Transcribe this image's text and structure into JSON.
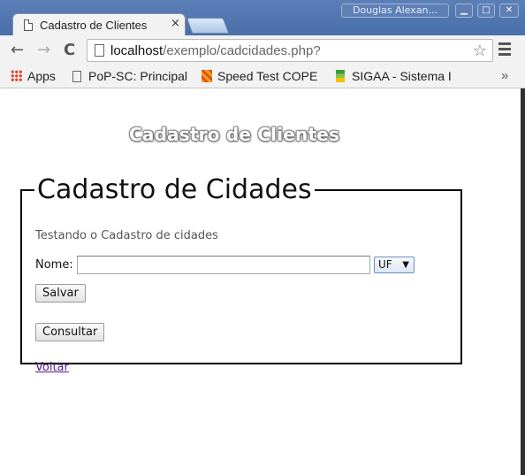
{
  "browser": {
    "tab": {
      "title": "Cadastro de Clientes",
      "close_glyph": "×",
      "icon": "page-icon"
    },
    "profile_name": "Douglas Alexan...",
    "window_controls": {
      "minimize": "▁",
      "maximize": "□",
      "close": "✕"
    },
    "nav": {
      "back": "←",
      "forward": "→",
      "reload": "C"
    },
    "address": {
      "host": "localhost",
      "path": "/exemplo/cadcidades.php?"
    },
    "star_glyph": "☆",
    "bookmarks": [
      {
        "label": "Apps",
        "icon": "apps-grid-icon"
      },
      {
        "label": "PoP-SC: Principal",
        "icon": "page-icon"
      },
      {
        "label": "Speed Test COPE",
        "icon": "speedtest-icon"
      },
      {
        "label": "SIGAA - Sistema I",
        "icon": "sigaa-icon"
      }
    ],
    "bookmarks_overflow": "»"
  },
  "page": {
    "site_title": "Cadastro de Clientes",
    "form": {
      "legend": "Cadastro de Cidades",
      "subtitle": "Testando o Cadastro de cidades",
      "nome_label": "Nome:",
      "nome_value": "",
      "uf_selected": "UF",
      "uf_caret": "▼",
      "save_label": "Salvar",
      "consult_label": "Consultar",
      "back_link": "Voltar"
    }
  },
  "colors": {
    "tabstrip": "#4a6ea8",
    "toolbar": "#f2f2f2",
    "visited_link": "#551a8b",
    "fieldset_border": "#000000"
  }
}
